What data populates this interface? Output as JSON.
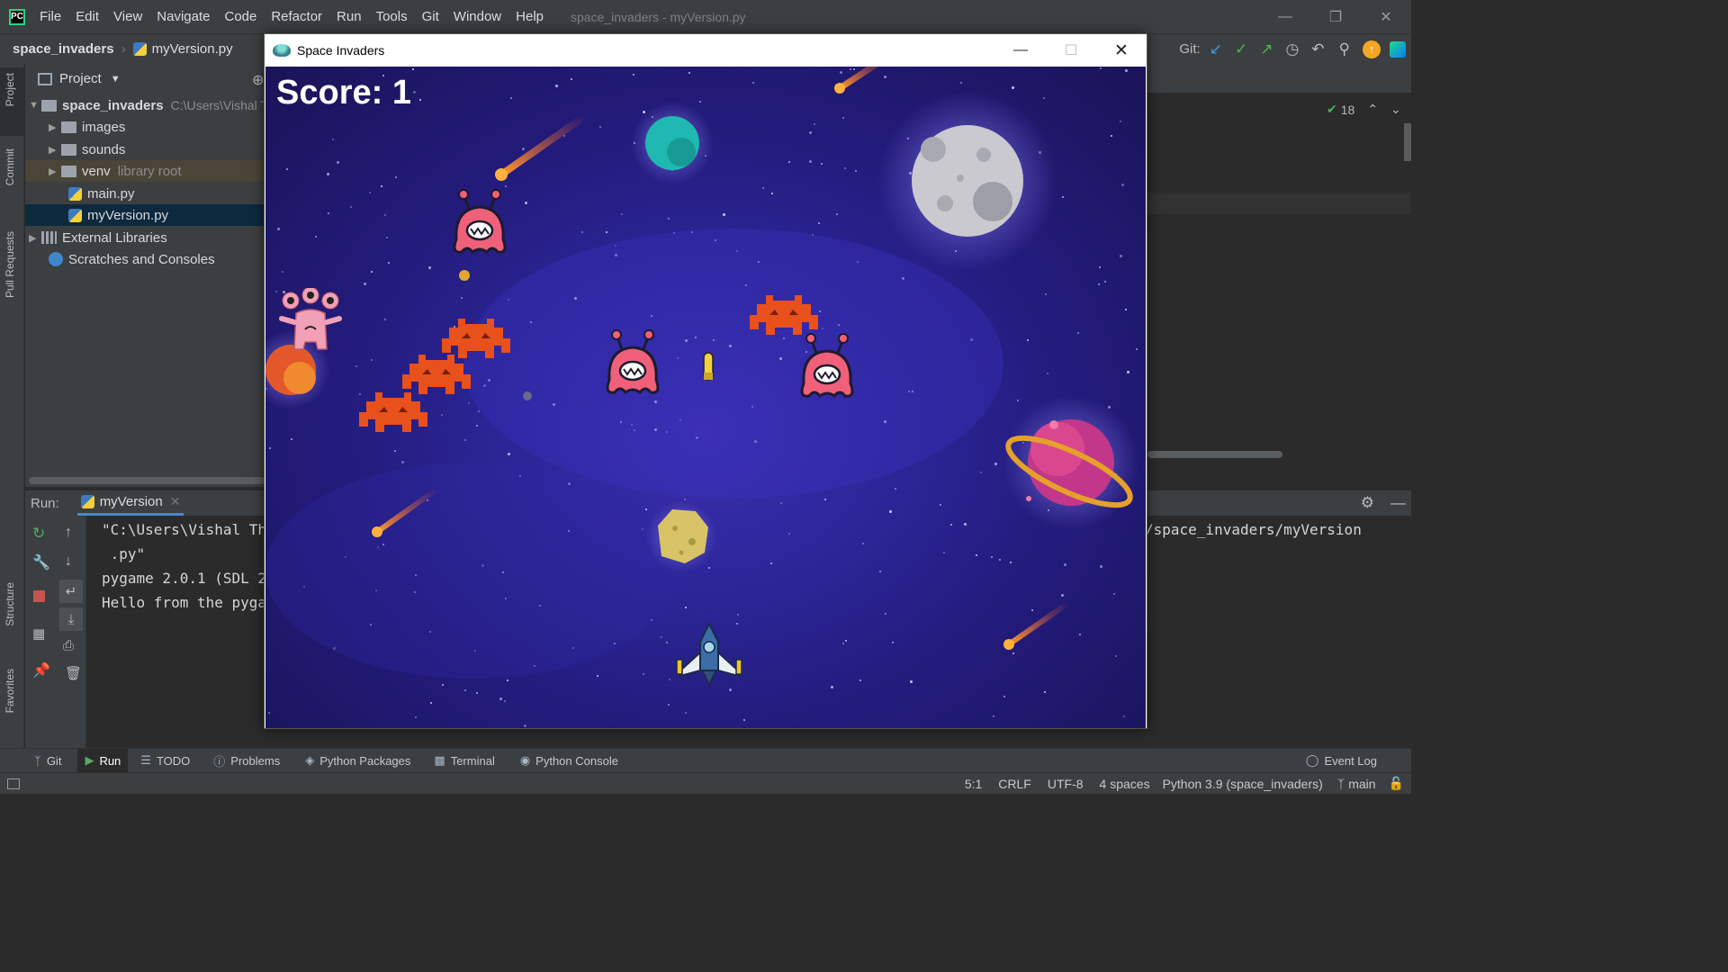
{
  "ide": {
    "menu": [
      "File",
      "Edit",
      "View",
      "Navigate",
      "Code",
      "Refactor",
      "Run",
      "Tools",
      "Git",
      "Window",
      "Help"
    ],
    "window_title": "space_invaders - myVersion.py",
    "breadcrumb": {
      "project": "space_invaders",
      "file": "myVersion.py"
    },
    "git_label": "Git:",
    "inspections_count": "18"
  },
  "side_tabs": {
    "project": "Project",
    "commit": "Commit",
    "pull_requests": "Pull Requests",
    "structure": "Structure",
    "favorites": "Favorites"
  },
  "project_panel": {
    "header": "Project",
    "root": {
      "name": "space_invaders",
      "path": "C:\\Users\\Vishal T"
    },
    "items": [
      {
        "label": "images",
        "type": "folder",
        "hint": ""
      },
      {
        "label": "sounds",
        "type": "folder",
        "hint": ""
      },
      {
        "label": "venv",
        "type": "folder",
        "hint": "library root"
      },
      {
        "label": "main.py",
        "type": "py",
        "hint": ""
      },
      {
        "label": "myVersion.py",
        "type": "py",
        "hint": ""
      }
    ],
    "external_libraries": "External Libraries",
    "scratches": "Scratches and Consoles"
  },
  "run_panel": {
    "label": "Run:",
    "config": "myVersion",
    "console": [
      "\"C:\\Users\\Vishal Th",
      " .py\"",
      "pygame 2.0.1 (SDL 2",
      "Hello from the pyga"
    ],
    "console_right": "/space_invaders/myVersion"
  },
  "bottom_tabs": [
    "Git",
    "Run",
    "TODO",
    "Problems",
    "Python Packages",
    "Terminal",
    "Python Console"
  ],
  "event_log": "Event Log",
  "status": {
    "position": "5:1",
    "line_sep": "CRLF",
    "encoding": "UTF-8",
    "indent": "4 spaces",
    "interpreter": "Python 3.9 (space_invaders)",
    "branch": "main"
  },
  "game": {
    "title": "Space Invaders",
    "score_text": "Score: 1",
    "colors": {
      "bg": "#231b7a",
      "crab": "#e8501c",
      "blob": "#f0607a",
      "ship": "#3a6ea5"
    }
  }
}
